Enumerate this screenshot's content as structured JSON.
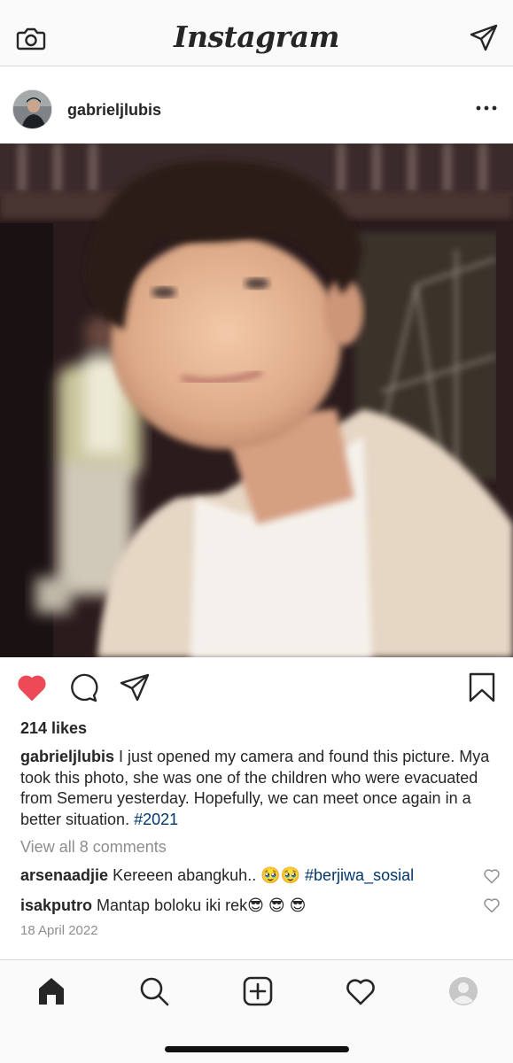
{
  "app": {
    "logo_text": "Instagram",
    "icons": {
      "left": "camera-icon",
      "right": "direct-message-icon"
    }
  },
  "post": {
    "username": "gabrieljlubis",
    "more_icon": "more-options-icon",
    "likes": "214 likes",
    "caption": {
      "username": "gabrieljlubis",
      "text": " I just opened my camera and found this picture. Mya took this photo, she was one of the children who were evacuated from Semeru yesterday. Hopefully, we can meet once again in a better situation. ",
      "hashtag": "#2021"
    },
    "view_comments": "View all 8 comments",
    "comments": [
      {
        "username": "arsenaadjie",
        "text": " Kereeen abangkuh.. ",
        "emojis": "🥹🥹",
        "hashtag": " #berjiwa_sosial"
      },
      {
        "username": "isakputro",
        "text": " Mantap boloku iki rek",
        "emojis": "😎 😎 😎"
      }
    ],
    "date": "18 April 2022",
    "liked": true,
    "colors": {
      "like_red": "#ed4956",
      "hashtag_blue": "#00376b",
      "muted": "#8e8e8e"
    }
  },
  "bottom_nav": [
    "home-icon",
    "search-icon",
    "new-post-icon",
    "activity-heart-icon",
    "profile-avatar-icon"
  ]
}
